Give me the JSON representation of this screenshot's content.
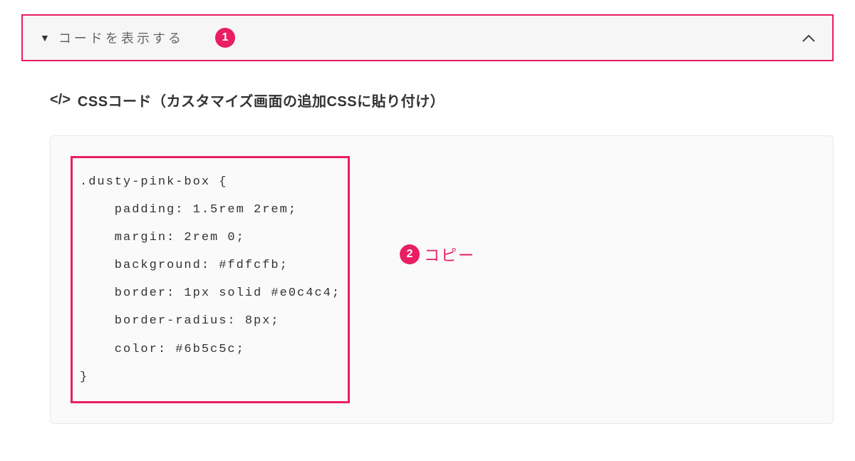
{
  "accordion": {
    "label": "コードを表示する",
    "badge1": "1"
  },
  "section": {
    "title": "CSSコード（カスタマイズ画面の追加CSSに貼り付け）"
  },
  "code": {
    "content": ".dusty-pink-box {\n    padding: 1.5rem 2rem;\n    margin: 2rem 0;\n    background: #fdfcfb;\n    border: 1px solid #e0c4c4;\n    border-radius: 8px;\n    color: #6b5c5c;\n}"
  },
  "copy": {
    "badge2": "2",
    "label": "コピー"
  }
}
